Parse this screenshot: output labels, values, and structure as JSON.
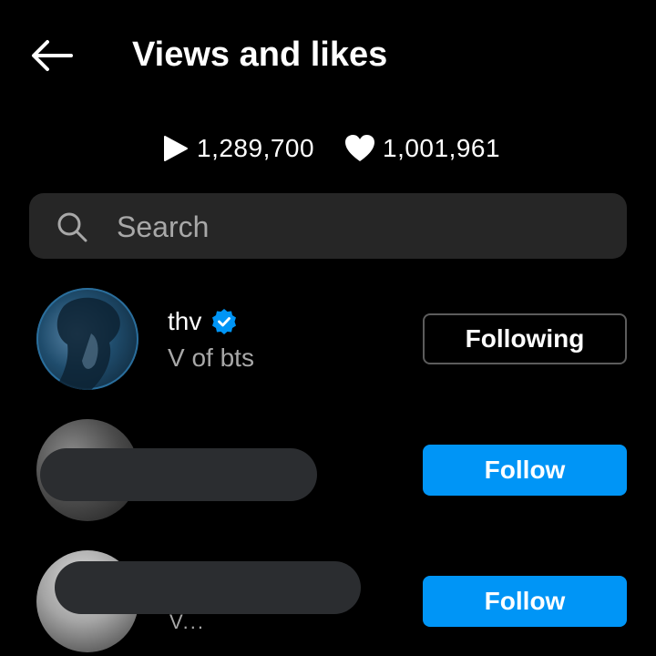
{
  "header": {
    "title": "Views and likes",
    "back_icon": "back-arrow-icon"
  },
  "stats": {
    "views": "1,289,700",
    "likes": "1,001,961",
    "views_icon": "play-icon",
    "likes_icon": "heart-icon"
  },
  "search": {
    "placeholder": "Search",
    "value": ""
  },
  "rows": [
    {
      "username": "thv",
      "verified": true,
      "full_name": "V of bts",
      "action_label": "Following",
      "redacted": false
    },
    {
      "username": "",
      "verified": false,
      "full_name": "",
      "action_label": "Follow",
      "redacted": true
    },
    {
      "username": "",
      "verified": false,
      "full_name": "",
      "partial_text": "V...",
      "action_label": "Follow",
      "redacted": true
    }
  ],
  "colors": {
    "background": "#000000",
    "search_bg": "#262626",
    "secondary_text": "#a8a8a8",
    "follow_blue": "#0095f6",
    "verified_blue": "#0095f6",
    "following_border": "#5c5c5c",
    "redaction": "#2b2d30"
  }
}
